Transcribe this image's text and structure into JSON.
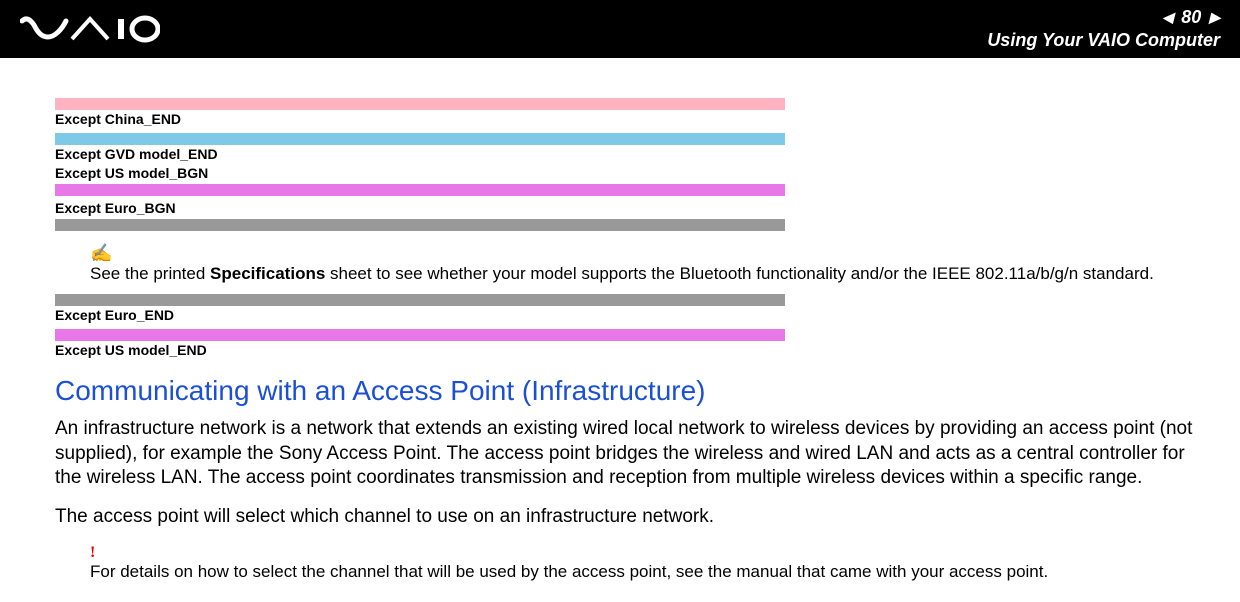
{
  "header": {
    "page_number": "80",
    "n_label": "n",
    "N_label": "N",
    "subtitle": "Using Your VAIO Computer"
  },
  "tags": {
    "except_china_end": "Except China_END",
    "except_gvd_end": "Except GVD model_END",
    "except_us_bgn": "Except US model_BGN",
    "except_euro_bgn": "Except Euro_BGN",
    "except_euro_end": "Except Euro_END",
    "except_us_end": "Except US model_END"
  },
  "note": {
    "icon": "✍",
    "prefix": "See the printed ",
    "bold": "Specifications",
    "suffix": " sheet to see whether your model supports the Bluetooth functionality and/or the IEEE 802.11a/b/g/n standard."
  },
  "section": {
    "heading": "Communicating with an Access Point (Infrastructure)",
    "para1": "An infrastructure network is a network that extends an existing wired local network to wireless devices by providing an access point (not supplied), for example the Sony Access Point. The access point bridges the wireless and wired LAN and acts as a central controller for the wireless LAN. The access point coordinates transmission and reception from multiple wireless devices within a specific range.",
    "para2": "The access point will select which channel to use on an infrastructure network."
  },
  "warning": {
    "icon": "!",
    "text": "For details on how to select the channel that will be used by the access point, see the manual that came with your access point."
  }
}
